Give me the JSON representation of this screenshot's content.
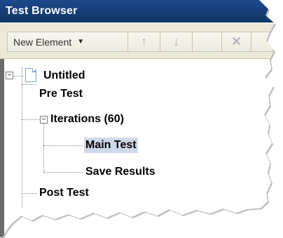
{
  "window": {
    "title": "Test Browser"
  },
  "toolbar": {
    "new_element_label": "New Element",
    "new_element_caret": "▼",
    "move_up_icon": "↑",
    "move_down_icon": "↓",
    "delete_icon": "✕"
  },
  "tree": {
    "root": {
      "label": "Untitled",
      "toggle": "−"
    },
    "items": {
      "pre_test": "Pre Test",
      "iterations": "Iterations  (60)",
      "iterations_toggle": "−",
      "main_test": "Main Test",
      "save_results": "Save Results",
      "post_test": "Post Test"
    }
  },
  "colors": {
    "titlebar": "#163f79",
    "selection": "#cfd9ea",
    "toolbar_bg": "#ece9d8"
  }
}
